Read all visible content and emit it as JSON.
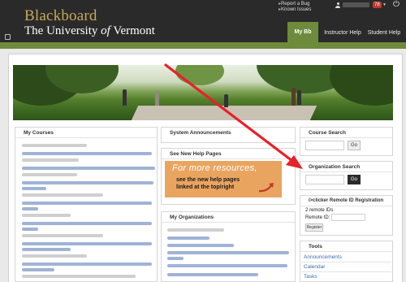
{
  "header": {
    "logo_line1": "Blackboard",
    "logo_line2_prefix": "The University",
    "logo_line2_of": "of",
    "logo_line2_suffix": "Vermont",
    "links": [
      "Report a Bug",
      "Known Issues"
    ],
    "notification_count": "78",
    "tabs": [
      "My Bb",
      "Instructor Help",
      "Student Help"
    ],
    "active_tab": "My Bb"
  },
  "modules": {
    "my_courses": "My Courses",
    "system_announcements": "System Announcements",
    "help_pages": "See New Help Pages",
    "my_organizations": "My Organizations",
    "course_search": "Course Search",
    "organization_search": "Organization Search",
    "iclicker": "i>clicker Remote ID Registration",
    "tools": "Tools"
  },
  "promo": {
    "line1": "For more resources,",
    "line2": "see the new help pages",
    "line3": "linked at the top/right"
  },
  "course_search": {
    "button": "Go"
  },
  "organization_search": {
    "button": "Go"
  },
  "iclicker": {
    "remote_ids_text": "2 remote IDs",
    "remote_id_label": "Remote ID:",
    "register_button": "Register"
  },
  "tools": [
    "Announcements",
    "Calendar",
    "Tasks"
  ],
  "colors": {
    "header_bg": "#2a2a2a",
    "accent_green": "#6d8b3a",
    "logo_gold": "#c6a85a",
    "promo_orange": "#e9a560",
    "annotation_red": "#e8202a",
    "link_blue": "#3b6bb4"
  }
}
